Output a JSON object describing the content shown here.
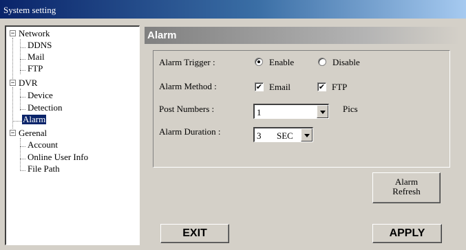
{
  "window": {
    "title": "System setting"
  },
  "tree": {
    "network": "Network",
    "ddns": "DDNS",
    "mail": "Mail",
    "ftp": "FTP",
    "dvr": "DVR",
    "device": "Device",
    "detection": "Detection",
    "alarm": "Alarm",
    "general": "Gerenal",
    "account": "Account",
    "online_user_info": "Online User Info",
    "file_path": "File Path",
    "expander_symbol": "−"
  },
  "panel": {
    "title": "Alarm",
    "alarm_trigger": {
      "label": "Alarm Trigger :",
      "options": [
        "Enable",
        "Disable"
      ],
      "selected": "Enable"
    },
    "alarm_method": {
      "label": "Alarm Method :",
      "email_label": "Email",
      "email_checked": true,
      "ftp_label": "FTP",
      "ftp_checked": true,
      "check_mark": "✔"
    },
    "post_numbers": {
      "label": "Post Numbers :",
      "value": "1",
      "unit": "Pics"
    },
    "alarm_duration": {
      "label": "Alarm Duration :",
      "value": "3",
      "unit": "SEC"
    }
  },
  "buttons": {
    "alarm_refresh_line1": "Alarm",
    "alarm_refresh_line2": "Refresh",
    "exit": "EXIT",
    "apply": "APPLY"
  }
}
